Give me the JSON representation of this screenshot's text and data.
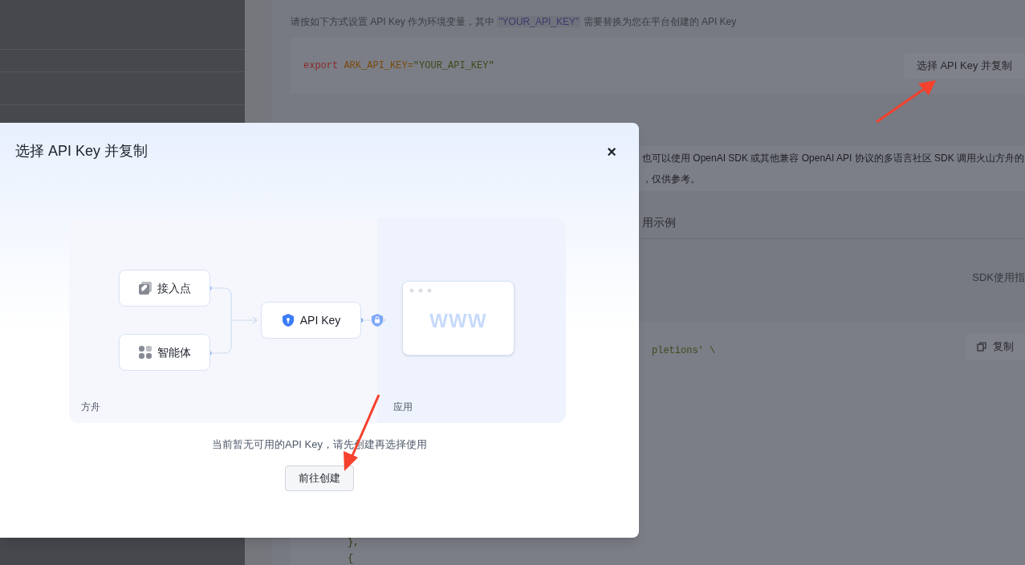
{
  "page": {
    "description": "请按如下方式设置 API Key 作为环境变量，其中 **\"YOUR_API_KEY\"** 需要替换为您在平台创建的 API Key",
    "code_line": {
      "keyword": "export",
      "name": "ARK_API_KEY=",
      "value": "\"YOUR_API_KEY\""
    },
    "select_button": "选择 API Key 并复制",
    "info_lines": [
      "也可以使用 OpenAI SDK 或其他兼容 OpenAI API 协议的多语言社区 SDK 调用火山方舟的",
      "，仅供参考。"
    ],
    "tab": "用示例",
    "sdk_link": "SDK使用指",
    "code_lines": [
      "pletions' \\"
    ],
    "copy_button": "复制",
    "tail_lines": [
      "},",
      "{"
    ]
  },
  "dialog": {
    "title": "选择 API Key 并复制",
    "close": "×",
    "diagram": {
      "sources": [
        {
          "kind": "endpoint",
          "label": "接入点"
        },
        {
          "kind": "agent",
          "label": "智能体"
        }
      ],
      "key_label": "API Key",
      "browser_text": "WWW",
      "left_label": "方舟",
      "right_label": "应用"
    },
    "message": "当前暂无可用的API Key，请先创建再选择使用",
    "create_button": "前往创建"
  }
}
